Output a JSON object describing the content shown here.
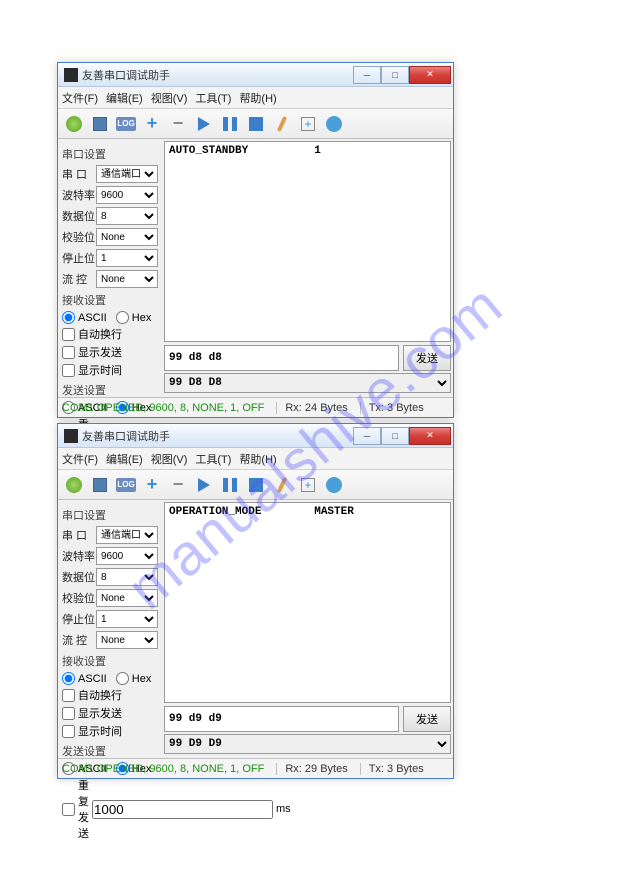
{
  "watermark": "manualshive.com",
  "title": "友善串口调试助手",
  "menu": {
    "file": "文件(F)",
    "edit": "编辑(E)",
    "view": "视图(V)",
    "tools": "工具(T)",
    "help": "帮助(H)"
  },
  "log_label": "LOG",
  "serial": {
    "section": "串口设置",
    "port_lbl": "串 口",
    "port_val": "通信端口(C",
    "baud_lbl": "波特率",
    "baud_val": "9600",
    "data_lbl": "数据位",
    "data_val": "8",
    "parity_lbl": "校验位",
    "parity_val": "None",
    "stop_lbl": "停止位",
    "stop_val": "1",
    "flow_lbl": "流 控",
    "flow_val": "None"
  },
  "recv": {
    "section": "接收设置",
    "ascii": "ASCII",
    "hex": "Hex",
    "autowrap": "自动换行",
    "showsend": "显示发送",
    "showtime": "显示时间"
  },
  "send": {
    "section": "发送设置",
    "ascii": "ASCII",
    "hex": "Hex",
    "repeat_lbl": "重复发送",
    "repeat_val": "1000",
    "repeat_unit": "ms",
    "button": "发送"
  },
  "w1": {
    "output": "AUTO_STANDBY          1",
    "input": "99 d8 d8",
    "dropdown": "99 D8 D8",
    "status_conn": "COM1 OPENED, 9600, 8, NONE, 1, OFF",
    "status_rx": "Rx: 24 Bytes",
    "status_tx": "Tx: 3 Bytes"
  },
  "w2": {
    "output": "OPERATION_MODE        MASTER",
    "input": "99 d9 d9",
    "dropdown": "99 D9 D9",
    "status_conn": "COM1 OPENED, 9600, 8, NONE, 1, OFF",
    "status_rx": "Rx: 29 Bytes",
    "status_tx": "Tx: 3 Bytes"
  }
}
